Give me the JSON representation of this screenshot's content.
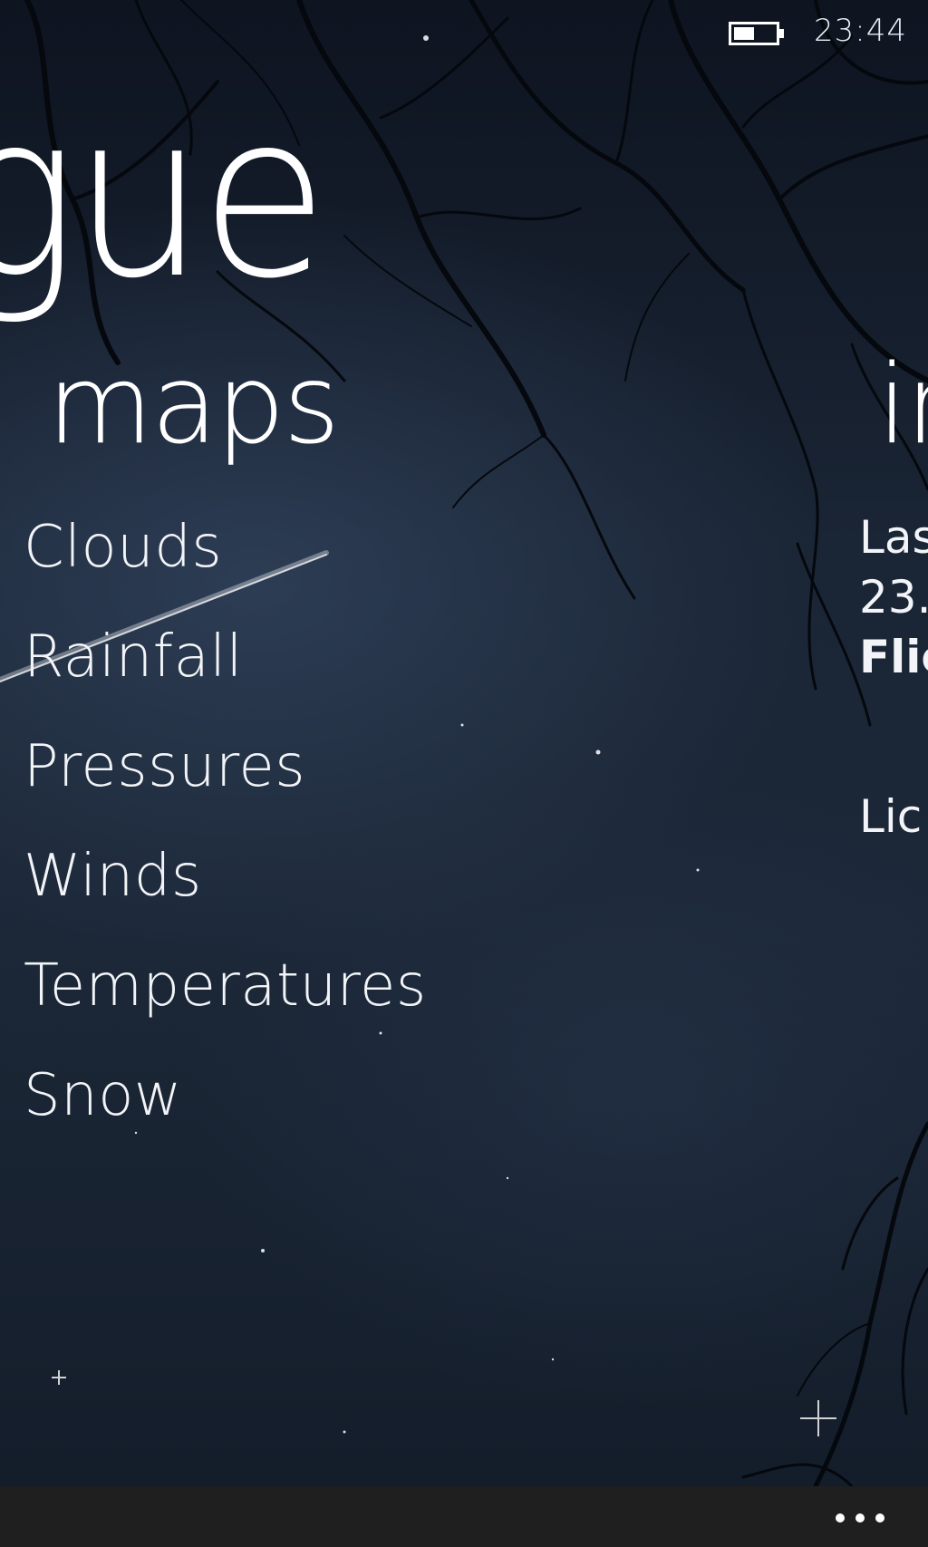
{
  "status_bar": {
    "battery_icon": "battery-icon",
    "time": "23:44"
  },
  "pivot": {
    "title_fragment": "gue",
    "sections": [
      {
        "header": "maps",
        "items": [
          "Clouds",
          "Rainfall",
          "Pressures",
          "Winds",
          "Temperatures",
          "Snow"
        ]
      },
      {
        "header": "in",
        "lines": [
          "Las",
          "23.",
          "Flic",
          "Lic"
        ]
      }
    ]
  },
  "app_bar": {
    "more_icon": "more-icon"
  },
  "colors": {
    "background_top": "#0e1420",
    "background_mid": "#1c2838",
    "app_bar": "#1f1f1f",
    "text": "#ffffff"
  }
}
